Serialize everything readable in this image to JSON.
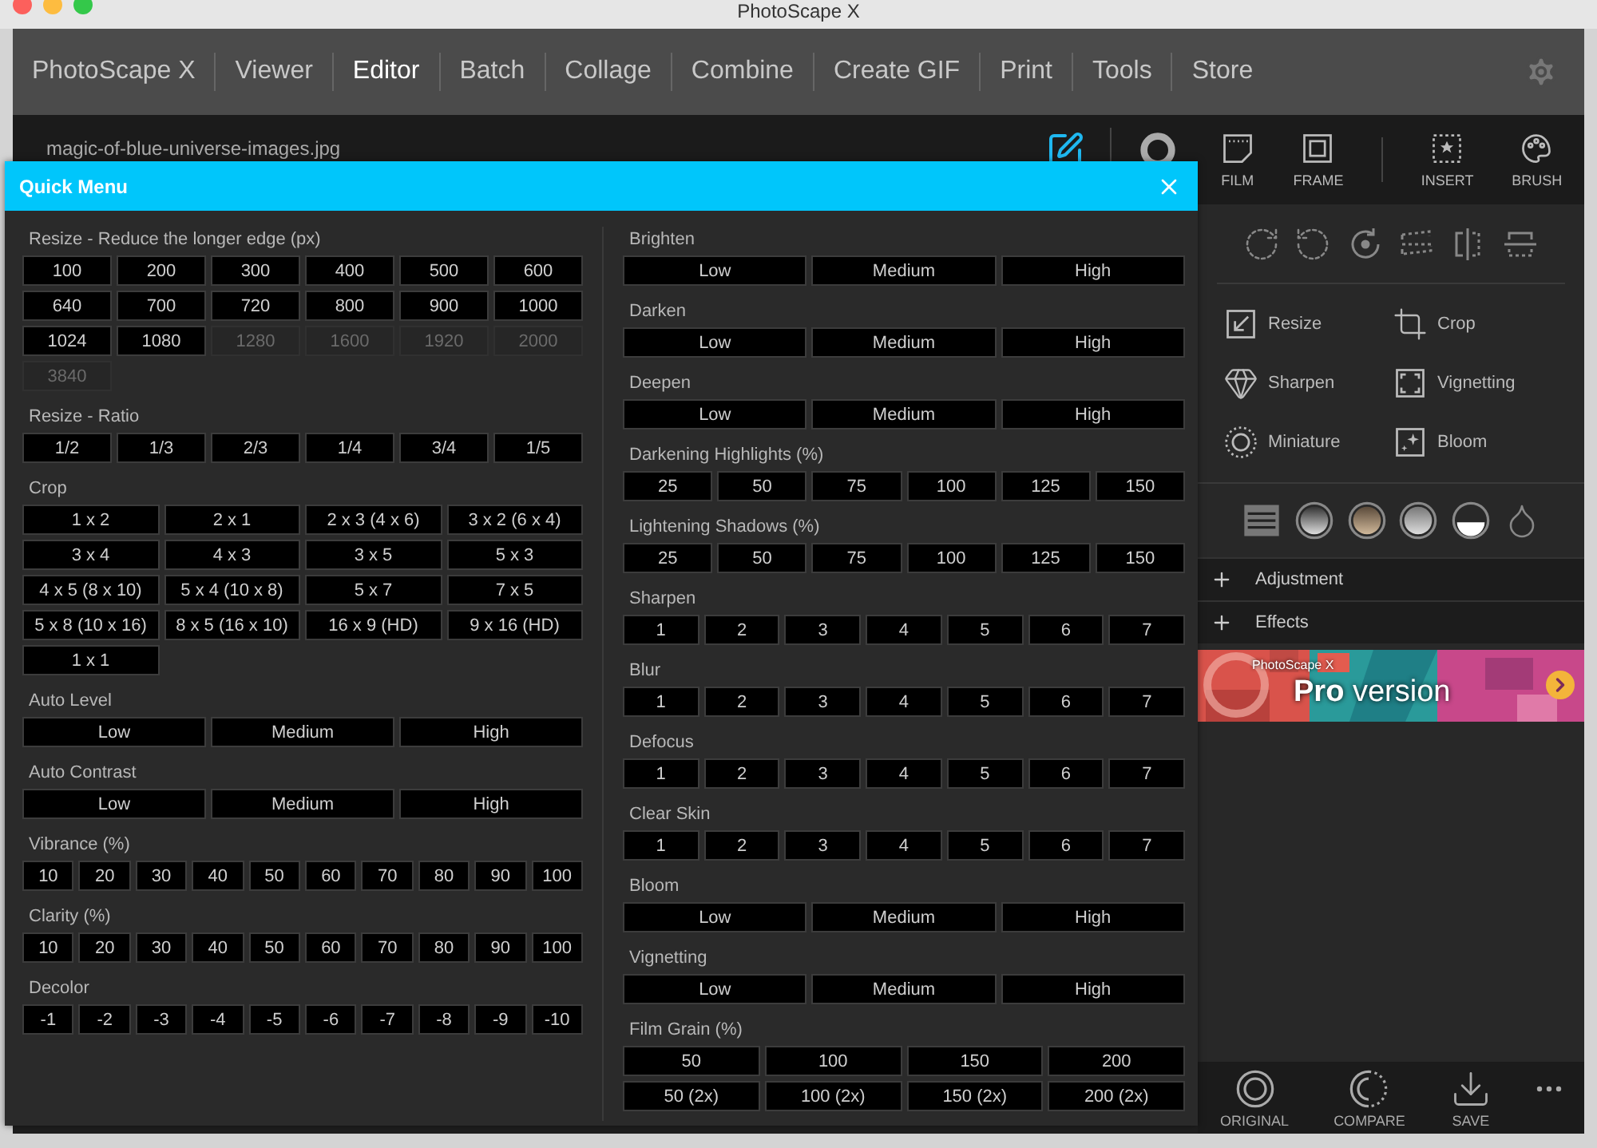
{
  "window": {
    "title": "PhotoScape X"
  },
  "nav": [
    {
      "label": "PhotoScape X",
      "selected": false
    },
    {
      "label": "Viewer",
      "selected": false
    },
    {
      "label": "Editor",
      "selected": true
    },
    {
      "label": "Batch",
      "selected": false
    },
    {
      "label": "Collage",
      "selected": false
    },
    {
      "label": "Combine",
      "selected": false
    },
    {
      "label": "Create GIF",
      "selected": false
    },
    {
      "label": "Print",
      "selected": false
    },
    {
      "label": "Tools",
      "selected": false
    },
    {
      "label": "Store",
      "selected": false
    }
  ],
  "editor": {
    "filename": "magic-of-blue-universe-images.jpg"
  },
  "quick_menu": {
    "title": "Quick Menu",
    "columns": [
      [
        {
          "title": "Resize - Reduce the longer edge (px)",
          "rows": [
            [
              {
                "label": "100",
                "disabled": false
              },
              {
                "label": "200",
                "disabled": false
              },
              {
                "label": "300",
                "disabled": false
              },
              {
                "label": "400",
                "disabled": false
              },
              {
                "label": "500",
                "disabled": false
              },
              {
                "label": "600",
                "disabled": false
              }
            ],
            [
              {
                "label": "640",
                "disabled": false
              },
              {
                "label": "700",
                "disabled": false
              },
              {
                "label": "720",
                "disabled": false
              },
              {
                "label": "800",
                "disabled": false
              },
              {
                "label": "900",
                "disabled": false
              },
              {
                "label": "1000",
                "disabled": false
              }
            ],
            [
              {
                "label": "1024",
                "disabled": false
              },
              {
                "label": "1080",
                "disabled": false
              },
              {
                "label": "1280",
                "disabled": true
              },
              {
                "label": "1600",
                "disabled": true
              },
              {
                "label": "1920",
                "disabled": true
              },
              {
                "label": "2000",
                "disabled": true
              }
            ],
            [
              {
                "label": "3840",
                "disabled": true
              }
            ]
          ]
        },
        {
          "title": "Resize - Ratio",
          "rows": [
            [
              {
                "label": "1/2",
                "disabled": false
              },
              {
                "label": "1/3",
                "disabled": false
              },
              {
                "label": "2/3",
                "disabled": false
              },
              {
                "label": "1/4",
                "disabled": false
              },
              {
                "label": "3/4",
                "disabled": false
              },
              {
                "label": "1/5",
                "disabled": false
              }
            ]
          ]
        },
        {
          "title": "Crop",
          "rows": [
            [
              {
                "label": "1 x 2",
                "disabled": false
              },
              {
                "label": "2 x 1",
                "disabled": false
              },
              {
                "label": "2 x 3 (4 x 6)",
                "disabled": false
              },
              {
                "label": "3 x 2 (6 x 4)",
                "disabled": false
              }
            ],
            [
              {
                "label": "3 x 4",
                "disabled": false
              },
              {
                "label": "4 x 3",
                "disabled": false
              },
              {
                "label": "3 x 5",
                "disabled": false
              },
              {
                "label": "5 x 3",
                "disabled": false
              }
            ],
            [
              {
                "label": "4 x 5 (8 x 10)",
                "disabled": false
              },
              {
                "label": "5 x 4 (10 x 8)",
                "disabled": false
              },
              {
                "label": "5 x 7",
                "disabled": false
              },
              {
                "label": "7 x 5",
                "disabled": false
              }
            ],
            [
              {
                "label": "5 x 8 (10 x 16)",
                "disabled": false
              },
              {
                "label": "8 x 5 (16 x 10)",
                "disabled": false
              },
              {
                "label": "16 x 9 (HD)",
                "disabled": false
              },
              {
                "label": "9 x 16 (HD)",
                "disabled": false
              }
            ],
            [
              {
                "label": "1 x 1",
                "disabled": false
              }
            ]
          ]
        },
        {
          "title": "Auto Level",
          "rows": [
            [
              {
                "label": "Low",
                "disabled": false
              },
              {
                "label": "Medium",
                "disabled": false
              },
              {
                "label": "High",
                "disabled": false
              }
            ]
          ]
        },
        {
          "title": "Auto Contrast",
          "rows": [
            [
              {
                "label": "Low",
                "disabled": false
              },
              {
                "label": "Medium",
                "disabled": false
              },
              {
                "label": "High",
                "disabled": false
              }
            ]
          ]
        },
        {
          "title": "Vibrance (%)",
          "rows": [
            [
              {
                "label": "10",
                "disabled": false
              },
              {
                "label": "20",
                "disabled": false
              },
              {
                "label": "30",
                "disabled": false
              },
              {
                "label": "40",
                "disabled": false
              },
              {
                "label": "50",
                "disabled": false
              },
              {
                "label": "60",
                "disabled": false
              },
              {
                "label": "70",
                "disabled": false
              },
              {
                "label": "80",
                "disabled": false
              },
              {
                "label": "90",
                "disabled": false
              },
              {
                "label": "100",
                "disabled": false
              }
            ]
          ]
        },
        {
          "title": "Clarity (%)",
          "rows": [
            [
              {
                "label": "10",
                "disabled": false
              },
              {
                "label": "20",
                "disabled": false
              },
              {
                "label": "30",
                "disabled": false
              },
              {
                "label": "40",
                "disabled": false
              },
              {
                "label": "50",
                "disabled": false
              },
              {
                "label": "60",
                "disabled": false
              },
              {
                "label": "70",
                "disabled": false
              },
              {
                "label": "80",
                "disabled": false
              },
              {
                "label": "90",
                "disabled": false
              },
              {
                "label": "100",
                "disabled": false
              }
            ]
          ]
        },
        {
          "title": "Decolor",
          "rows": [
            [
              {
                "label": "-1",
                "disabled": false
              },
              {
                "label": "-2",
                "disabled": false
              },
              {
                "label": "-3",
                "disabled": false
              },
              {
                "label": "-4",
                "disabled": false
              },
              {
                "label": "-5",
                "disabled": false
              },
              {
                "label": "-6",
                "disabled": false
              },
              {
                "label": "-7",
                "disabled": false
              },
              {
                "label": "-8",
                "disabled": false
              },
              {
                "label": "-9",
                "disabled": false
              },
              {
                "label": "-10",
                "disabled": false
              }
            ]
          ]
        }
      ],
      [
        {
          "title": "Brighten",
          "rows": [
            [
              {
                "label": "Low",
                "disabled": false
              },
              {
                "label": "Medium",
                "disabled": false
              },
              {
                "label": "High",
                "disabled": false
              }
            ]
          ]
        },
        {
          "title": "Darken",
          "rows": [
            [
              {
                "label": "Low",
                "disabled": false
              },
              {
                "label": "Medium",
                "disabled": false
              },
              {
                "label": "High",
                "disabled": false
              }
            ]
          ]
        },
        {
          "title": "Deepen",
          "rows": [
            [
              {
                "label": "Low",
                "disabled": false
              },
              {
                "label": "Medium",
                "disabled": false
              },
              {
                "label": "High",
                "disabled": false
              }
            ]
          ]
        },
        {
          "title": "Darkening Highlights (%)",
          "rows": [
            [
              {
                "label": "25",
                "disabled": false
              },
              {
                "label": "50",
                "disabled": false
              },
              {
                "label": "75",
                "disabled": false
              },
              {
                "label": "100",
                "disabled": false
              },
              {
                "label": "125",
                "disabled": false
              },
              {
                "label": "150",
                "disabled": false
              }
            ]
          ]
        },
        {
          "title": "Lightening Shadows (%)",
          "rows": [
            [
              {
                "label": "25",
                "disabled": false
              },
              {
                "label": "50",
                "disabled": false
              },
              {
                "label": "75",
                "disabled": false
              },
              {
                "label": "100",
                "disabled": false
              },
              {
                "label": "125",
                "disabled": false
              },
              {
                "label": "150",
                "disabled": false
              }
            ]
          ]
        },
        {
          "title": "Sharpen",
          "rows": [
            [
              {
                "label": "1",
                "disabled": false
              },
              {
                "label": "2",
                "disabled": false
              },
              {
                "label": "3",
                "disabled": false
              },
              {
                "label": "4",
                "disabled": false
              },
              {
                "label": "5",
                "disabled": false
              },
              {
                "label": "6",
                "disabled": false
              },
              {
                "label": "7",
                "disabled": false
              }
            ]
          ]
        },
        {
          "title": "Blur",
          "rows": [
            [
              {
                "label": "1",
                "disabled": false
              },
              {
                "label": "2",
                "disabled": false
              },
              {
                "label": "3",
                "disabled": false
              },
              {
                "label": "4",
                "disabled": false
              },
              {
                "label": "5",
                "disabled": false
              },
              {
                "label": "6",
                "disabled": false
              },
              {
                "label": "7",
                "disabled": false
              }
            ]
          ]
        },
        {
          "title": "Defocus",
          "rows": [
            [
              {
                "label": "1",
                "disabled": false
              },
              {
                "label": "2",
                "disabled": false
              },
              {
                "label": "3",
                "disabled": false
              },
              {
                "label": "4",
                "disabled": false
              },
              {
                "label": "5",
                "disabled": false
              },
              {
                "label": "6",
                "disabled": false
              },
              {
                "label": "7",
                "disabled": false
              }
            ]
          ]
        },
        {
          "title": "Clear Skin",
          "rows": [
            [
              {
                "label": "1",
                "disabled": false
              },
              {
                "label": "2",
                "disabled": false
              },
              {
                "label": "3",
                "disabled": false
              },
              {
                "label": "4",
                "disabled": false
              },
              {
                "label": "5",
                "disabled": false
              },
              {
                "label": "6",
                "disabled": false
              },
              {
                "label": "7",
                "disabled": false
              }
            ]
          ]
        },
        {
          "title": "Bloom",
          "rows": [
            [
              {
                "label": "Low",
                "disabled": false
              },
              {
                "label": "Medium",
                "disabled": false
              },
              {
                "label": "High",
                "disabled": false
              }
            ]
          ]
        },
        {
          "title": "Vignetting",
          "rows": [
            [
              {
                "label": "Low",
                "disabled": false
              },
              {
                "label": "Medium",
                "disabled": false
              },
              {
                "label": "High",
                "disabled": false
              }
            ]
          ]
        },
        {
          "title": "Film Grain (%)",
          "rows": [
            [
              {
                "label": "50",
                "disabled": false
              },
              {
                "label": "100",
                "disabled": false
              },
              {
                "label": "150",
                "disabled": false
              },
              {
                "label": "200",
                "disabled": false
              }
            ],
            [
              {
                "label": "50 (2x)",
                "disabled": false
              },
              {
                "label": "100 (2x)",
                "disabled": false
              },
              {
                "label": "150 (2x)",
                "disabled": false
              },
              {
                "label": "200 (2x)",
                "disabled": false
              }
            ]
          ]
        }
      ]
    ]
  },
  "side_panel": {
    "tabs": [
      {
        "label": "FILM"
      },
      {
        "label": "FRAME"
      },
      {
        "label": "INSERT"
      },
      {
        "label": "BRUSH"
      }
    ],
    "tools": [
      {
        "label": "Resize"
      },
      {
        "label": "Crop"
      },
      {
        "label": "Sharpen"
      },
      {
        "label": "Vignetting"
      },
      {
        "label": "Miniature"
      },
      {
        "label": "Bloom"
      }
    ],
    "sections": [
      {
        "label": "Adjustment",
        "expanded": false
      },
      {
        "label": "Effects",
        "expanded": false
      }
    ],
    "promo": {
      "brand": "PhotoScape X",
      "headline": "**Pro** version"
    }
  },
  "bottom_bar": [
    {
      "label": "ORIGINAL"
    },
    {
      "label": "COMPARE"
    },
    {
      "label": "SAVE"
    }
  ]
}
